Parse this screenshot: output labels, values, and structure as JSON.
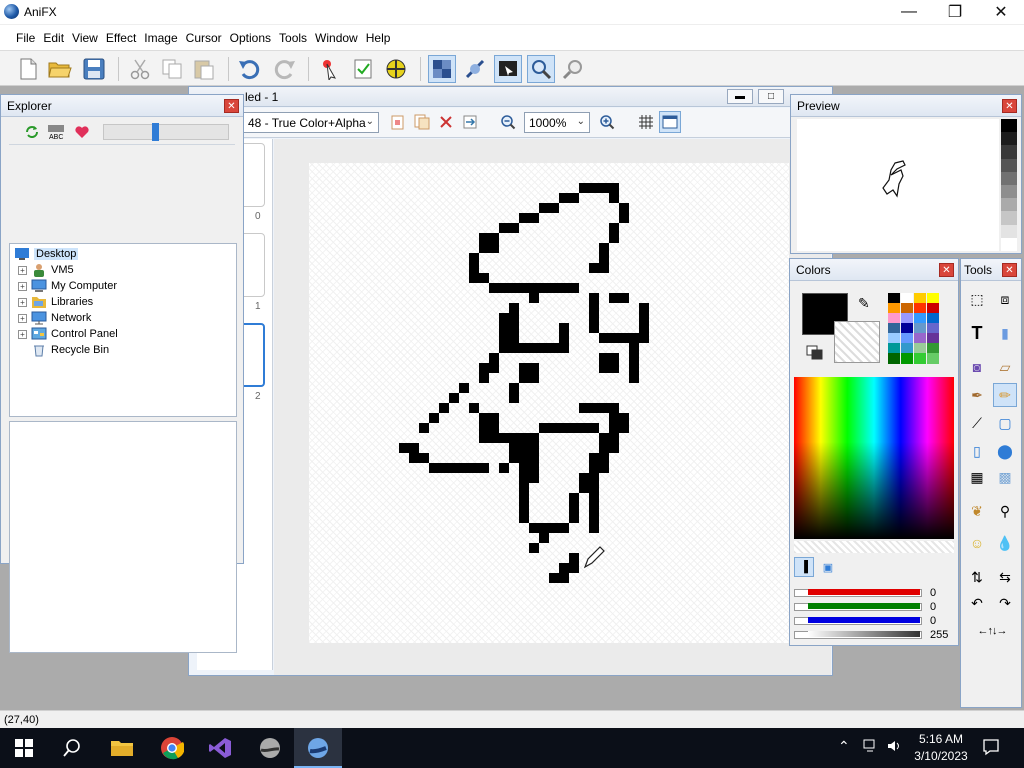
{
  "app": {
    "title": "AniFX"
  },
  "menu": [
    "File",
    "Edit",
    "View",
    "Effect",
    "Image",
    "Cursor",
    "Options",
    "Tools",
    "Window",
    "Help"
  ],
  "document": {
    "title": "led - 1",
    "color_mode": "48 - True Color+Alpha",
    "zoom": "1000%",
    "frames": [
      "0",
      "1",
      "2"
    ]
  },
  "explorer": {
    "title": "Explorer",
    "tree": [
      {
        "label": "Desktop",
        "icon": "desktop-icon",
        "expandable": false,
        "level": 0
      },
      {
        "label": "VM5",
        "icon": "user-icon",
        "expandable": true,
        "level": 1
      },
      {
        "label": "My Computer",
        "icon": "computer-icon",
        "expandable": true,
        "level": 1
      },
      {
        "label": "Libraries",
        "icon": "folder-icon",
        "expandable": true,
        "level": 1
      },
      {
        "label": "Network",
        "icon": "network-icon",
        "expandable": true,
        "level": 1
      },
      {
        "label": "Control Panel",
        "icon": "control-panel-icon",
        "expandable": true,
        "level": 1
      },
      {
        "label": "Recycle Bin",
        "icon": "recycle-bin-icon",
        "expandable": false,
        "level": 1
      }
    ]
  },
  "preview": {
    "title": "Preview"
  },
  "colors": {
    "title": "Colors",
    "primary": "#000000",
    "channels": [
      {
        "name": "red",
        "value": "0",
        "color": "#e00000",
        "fill": 0
      },
      {
        "name": "green",
        "value": "0",
        "color": "#008000",
        "fill": 0
      },
      {
        "name": "blue",
        "value": "0",
        "color": "#0000e0",
        "fill": 0
      },
      {
        "name": "alpha",
        "value": "255",
        "color": "#555555",
        "fill": 1
      }
    ],
    "swatches": [
      "#000000",
      "#ffffff",
      "#ffcc00",
      "#ffff00",
      "#ff9900",
      "#cc6600",
      "#ff3300",
      "#cc0000",
      "#ff99cc",
      "#9999ff",
      "#3399ff",
      "#0066cc",
      "#336699",
      "#000099",
      "#6699cc",
      "#6666cc",
      "#99ccff",
      "#6699ff",
      "#9966cc",
      "#663399",
      "#009999",
      "#3399cc",
      "#99cc99",
      "#339933",
      "#006600",
      "#009900",
      "#33cc33",
      "#66cc66"
    ]
  },
  "tools": {
    "title": "Tools"
  },
  "status": {
    "coords": "(27,40)"
  },
  "clock": {
    "time": "5:16 AM",
    "date": "3/10/2023"
  }
}
